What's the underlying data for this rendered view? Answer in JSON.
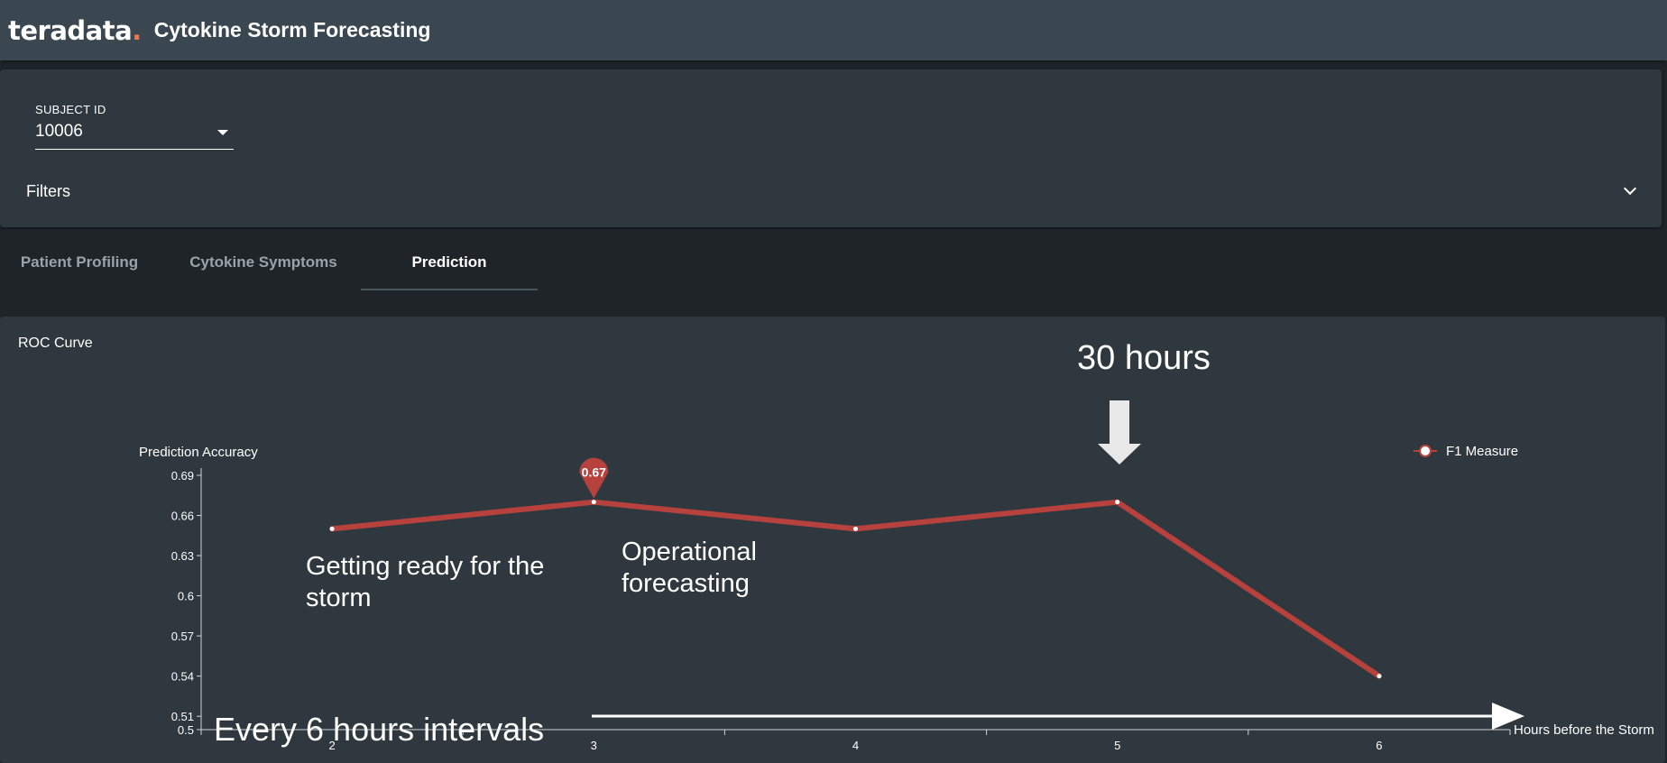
{
  "header": {
    "logo_text": "teradata",
    "logo_dot": ".",
    "app_title": "Cytokine Storm Forecasting"
  },
  "filters": {
    "subject_label": "SUBJECT ID",
    "subject_value": "10006",
    "filters_label": "Filters"
  },
  "tabs": [
    {
      "label": "Patient Profiling",
      "active": false
    },
    {
      "label": "Cytokine Symptoms",
      "active": false
    },
    {
      "label": "Prediction",
      "active": true
    }
  ],
  "card": {
    "title": "ROC Curve"
  },
  "annotations": {
    "top_callout": "30 hours",
    "left_note_line1": "Getting ready for the",
    "left_note_line2": "storm",
    "mid_note_line1": "Operational",
    "mid_note_line2": "forecasting",
    "bottom_note": "Every 6 hours intervals"
  },
  "colors": {
    "line": "#b7423d",
    "accent": "#f37440"
  },
  "chart_data": {
    "type": "line",
    "ylabel": "Prediction Accuracy",
    "xlabel": "Hours before the Storm",
    "y_ticks": [
      "0.5",
      "0.51",
      "0.54",
      "0.57",
      "0.6",
      "0.63",
      "0.66",
      "0.69"
    ],
    "x": [
      2,
      3,
      4,
      5,
      6
    ],
    "series": [
      {
        "name": "F1 Measure",
        "values": [
          0.65,
          0.67,
          0.65,
          0.67,
          0.54
        ]
      }
    ],
    "max_marker": {
      "x": 3,
      "label": "0.67"
    },
    "legend": "top-right"
  }
}
